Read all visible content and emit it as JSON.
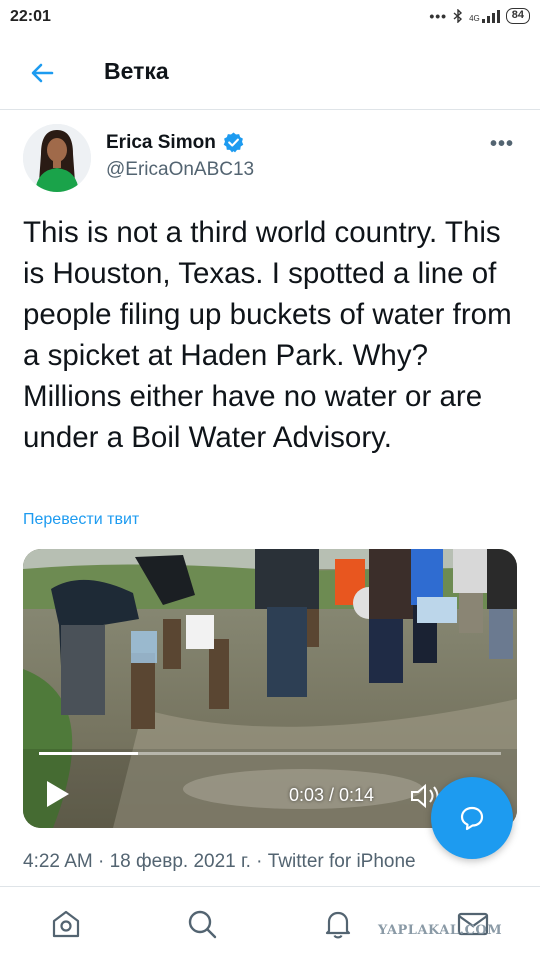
{
  "status_bar": {
    "time": "22:01",
    "dots": "•••",
    "bluetooth_icon": "bluetooth-icon",
    "network_label": "4G",
    "signal_icon": "signal-icon",
    "battery": "84"
  },
  "header": {
    "back_icon": "arrow-left-icon",
    "title": "Ветка"
  },
  "author": {
    "display_name": "Erica Simon",
    "verified_icon": "verified-badge-icon",
    "handle": "@EricaOnABC13",
    "more_icon": "more-dots-icon",
    "more_label": "•••"
  },
  "tweet": {
    "text": "This is not a third world country. This is Houston, Texas. I spotted a line of people filing up buckets of water from a spicket at Haden Park. Why? Millions either have no water or are under a Boil Water Advisory.",
    "translate_label": "Перевести твит"
  },
  "video": {
    "current_time": "0:03",
    "duration": "0:14",
    "time_display": "0:03 / 0:14",
    "progress_fraction": 0.214,
    "play_icon": "play-icon",
    "volume_icon": "volume-icon"
  },
  "meta": {
    "time": "4:22 AM",
    "date": "18 февр. 2021 г.",
    "source": "Twitter for iPhone",
    "full": "4:22 AM · 18 февр. 2021 г. · Twitter for iPhone"
  },
  "fab": {
    "icon": "compose-reply-icon"
  },
  "bottom_nav": {
    "items": [
      {
        "name": "home",
        "icon": "home-icon"
      },
      {
        "name": "search",
        "icon": "search-icon"
      },
      {
        "name": "notifications",
        "icon": "bell-icon"
      },
      {
        "name": "messages",
        "icon": "mail-icon"
      }
    ],
    "watermark": "YAPLAKAL.COM"
  },
  "colors": {
    "accent": "#1d9bf0",
    "text": "#0f1419",
    "secondary": "#536471",
    "divider": "#dfe4e8"
  }
}
